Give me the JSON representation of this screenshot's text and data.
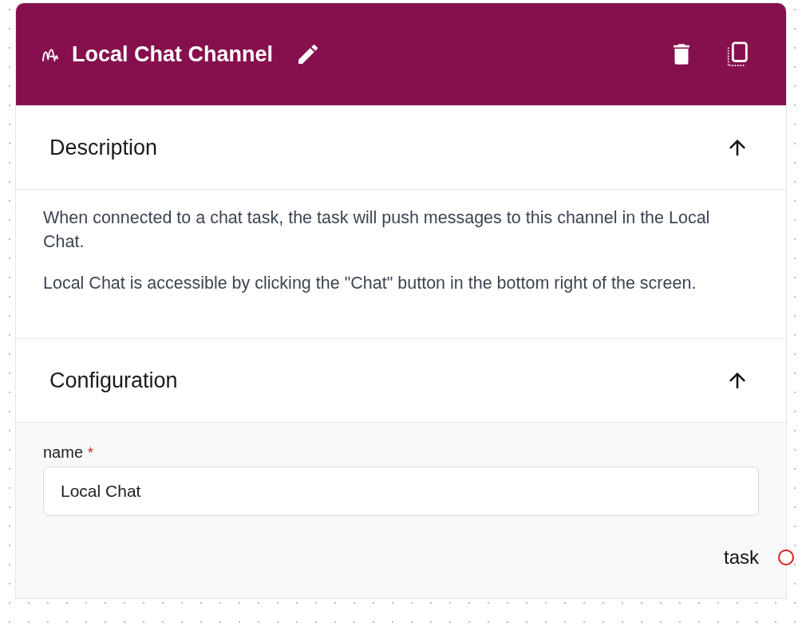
{
  "node": {
    "title": "Local Chat Channel"
  },
  "sections": [
    {
      "kind": "description",
      "title": "Description",
      "expanded": true,
      "paragraphs": [
        "When connected to a chat task, the task will push messages to this channel in the Local Chat.",
        "Local Chat is accessible by clicking the \"Chat\" button in the bottom right of the screen."
      ]
    },
    {
      "kind": "configuration",
      "title": "Configuration",
      "expanded": true,
      "fields": [
        {
          "label": "name",
          "required_mark": "*",
          "value": "Local Chat"
        }
      ]
    }
  ],
  "port": {
    "label": "task"
  }
}
